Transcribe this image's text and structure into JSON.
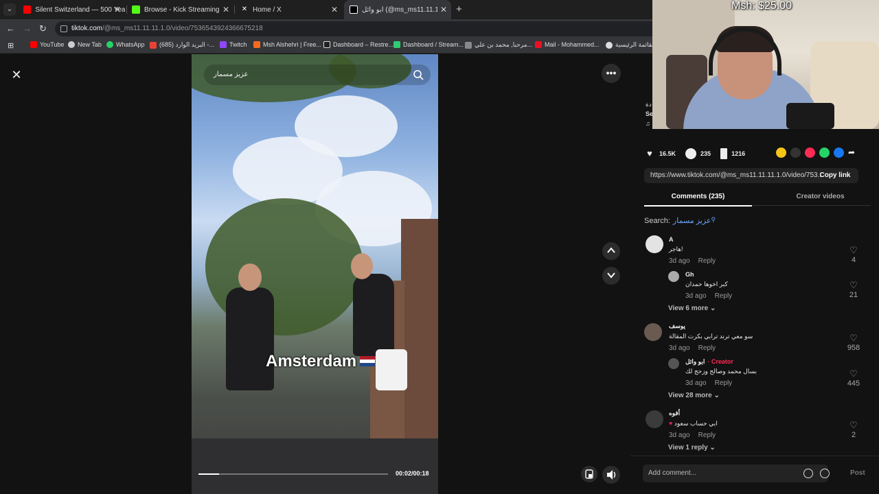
{
  "browser": {
    "tabs": [
      {
        "title": "Silent Switzerland — 500 Years",
        "icon_color": "#ff0000"
      },
      {
        "title": "Browse - Kick Streaming",
        "icon_color": "#53fc18"
      },
      {
        "title": "Home / X",
        "icon_color": "#ffffff"
      },
      {
        "title": "ابو وائل (@ms_ms11.11.11.1.0)",
        "icon_color": "#ffffff"
      }
    ],
    "url_host": "tiktok.com",
    "url_path": "/@ms_ms11.11.11.1.0/video/7536543924366675218",
    "bookmarks": [
      {
        "label": "YouTube",
        "color": "#ff0000"
      },
      {
        "label": "New Tab",
        "color": "#cccccc"
      },
      {
        "label": "WhatsApp",
        "color": "#25d366"
      },
      {
        "label": "(685) البريد الوارد -...",
        "color": "#ea4335"
      },
      {
        "label": "Twitch",
        "color": "#9146ff"
      },
      {
        "label": "Msh Alshehri | Free...",
        "color": "#f46b1f"
      },
      {
        "label": "Dashboard – Restre...",
        "color": "#222222"
      },
      {
        "label": "Dashboard / Stream...",
        "color": "#2ecc71"
      },
      {
        "label": "مرحبا, محمد بن علي...",
        "color": "#888888"
      },
      {
        "label": "Mail - Mohammed...",
        "color": "#e81123"
      },
      {
        "label": "القائمة الرئيسية",
        "color": "#dddddd"
      }
    ]
  },
  "video": {
    "search_text": "عزيز مسمار",
    "caption": "Amsterdam",
    "time": "00:02/00:18",
    "progress": 0.11
  },
  "panel": {
    "partial_text_1": "دة",
    "partial_text_2": "Se",
    "likes": "16.5K",
    "comments": "235",
    "saves": "1216",
    "link": "https://www.tiktok.com/@ms_ms11.11.11.1.0/video/753...",
    "copy_link": "Copy link",
    "tab_comments": "Comments (235)",
    "tab_creator": "Creator videos",
    "search_label": "Search:",
    "search_query": "عزيز مسمار",
    "add_comment_placeholder": "Add comment...",
    "post": "Post"
  },
  "comments": [
    {
      "name": "A",
      "text": "هاجر!",
      "time": "3d ago",
      "reply": "Reply",
      "likes": "4"
    },
    {
      "name": "Gh",
      "text": "كبر اخوها حمدان",
      "time": "3d ago",
      "reply": "Reply",
      "likes": "21"
    },
    {
      "view_more": "View 6 more"
    },
    {
      "name": "يوسف",
      "text": "سو معي ترند ترابي بكرت المقالة",
      "time": "3d ago",
      "reply": "Reply",
      "likes": "958"
    },
    {
      "name": "ابو وائل",
      "creator": "· Creator",
      "text": "بسال محمد وصالح وزحج لك",
      "time": "3d ago",
      "reply": "Reply",
      "likes": "445"
    },
    {
      "view_more": "View 28 more"
    },
    {
      "name": "أفوه",
      "text": "ابي حساب سعود",
      "time": "3d ago",
      "reply": "Reply",
      "likes": "2"
    },
    {
      "view_more": "View 1 reply"
    }
  ],
  "webcam": {
    "donation": "Msh: $25.00"
  }
}
